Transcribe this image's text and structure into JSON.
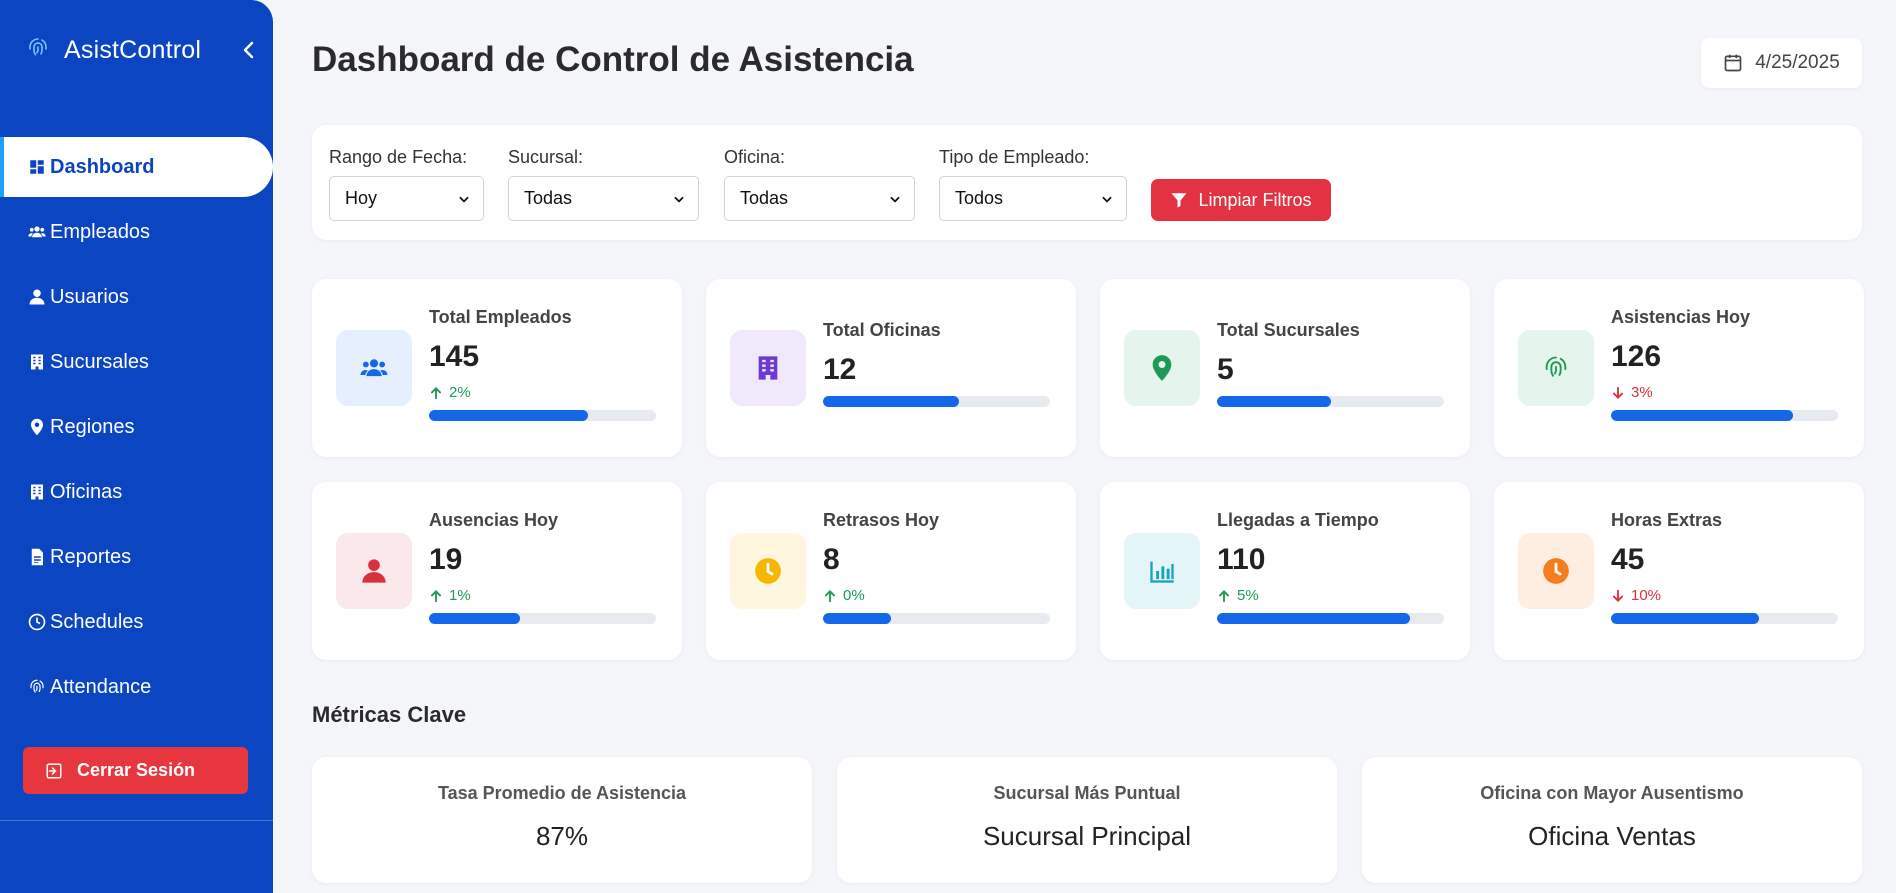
{
  "app": {
    "name": "AsistControl"
  },
  "sidebar": {
    "items": [
      {
        "label": "Dashboard",
        "icon": "dashboard-icon",
        "active": true
      },
      {
        "label": "Empleados",
        "icon": "users-icon"
      },
      {
        "label": "Usuarios",
        "icon": "user-icon"
      },
      {
        "label": "Sucursales",
        "icon": "building-icon"
      },
      {
        "label": "Regiones",
        "icon": "map-pin-icon"
      },
      {
        "label": "Oficinas",
        "icon": "building-icon"
      },
      {
        "label": "Reportes",
        "icon": "document-icon"
      },
      {
        "label": "Schedules",
        "icon": "clock-icon"
      },
      {
        "label": "Attendance",
        "icon": "fingerprint-icon"
      }
    ],
    "logout_label": "Cerrar Sesión"
  },
  "header": {
    "title": "Dashboard de Control de Asistencia",
    "date": "4/25/2025"
  },
  "filters": {
    "date_range": {
      "label": "Rango de Fecha:",
      "value": "Hoy"
    },
    "branch": {
      "label": "Sucursal:",
      "value": "Todas"
    },
    "office": {
      "label": "Oficina:",
      "value": "Todas"
    },
    "employee_type": {
      "label": "Tipo de Empleado:",
      "value": "Todos"
    },
    "clear_label": "Limpiar Filtros"
  },
  "stats": [
    {
      "label": "Total Empleados",
      "value": "145",
      "change": "2%",
      "trend": "up",
      "progress": 0.7,
      "icon": "users-icon",
      "icon_color": "#1367e8",
      "icon_bg": "#e5effd"
    },
    {
      "label": "Total Oficinas",
      "value": "12",
      "change": "",
      "trend": "",
      "progress": 0.6,
      "icon": "building-icon",
      "icon_color": "#6c3bd1",
      "icon_bg": "#efe9fb"
    },
    {
      "label": "Total Sucursales",
      "value": "5",
      "change": "",
      "trend": "",
      "progress": 0.5,
      "icon": "map-pin-icon",
      "icon_color": "#1e9a57",
      "icon_bg": "#e5f4ec"
    },
    {
      "label": "Asistencias Hoy",
      "value": "126",
      "change": "3%",
      "trend": "down",
      "progress": 0.8,
      "icon": "fingerprint-icon",
      "icon_color": "#1e9a57",
      "icon_bg": "#e5f4ec"
    },
    {
      "label": "Ausencias Hoy",
      "value": "19",
      "change": "1%",
      "trend": "up",
      "progress": 0.4,
      "icon": "user-icon",
      "icon_color": "#d9303f",
      "icon_bg": "#fae8ea"
    },
    {
      "label": "Retrasos Hoy",
      "value": "8",
      "change": "0%",
      "trend": "up",
      "progress": 0.3,
      "icon": "clock-icon",
      "icon_color": "#f5b700",
      "icon_bg": "#fff6df"
    },
    {
      "label": "Llegadas a Tiempo",
      "value": "110",
      "change": "5%",
      "trend": "up",
      "progress": 0.85,
      "icon": "bar-chart-icon",
      "icon_color": "#1aa3b8",
      "icon_bg": "#e4f5f8"
    },
    {
      "label": "Horas Extras",
      "value": "45",
      "change": "10%",
      "trend": "down",
      "progress": 0.65,
      "icon": "clock-icon",
      "icon_color": "#f57c1f",
      "icon_bg": "#fdeee1"
    }
  ],
  "key_metrics": {
    "title": "Métricas Clave",
    "items": [
      {
        "label": "Tasa Promedio de Asistencia",
        "value": "87%"
      },
      {
        "label": "Sucursal Más Puntual",
        "value": "Sucursal Principal"
      },
      {
        "label": "Oficina con Mayor Ausentismo",
        "value": "Oficina Ventas"
      }
    ]
  },
  "colors": {
    "sidebar": "#0b45c1",
    "primary": "#1367e8",
    "danger": "#e33343",
    "success": "#1e9a57"
  }
}
